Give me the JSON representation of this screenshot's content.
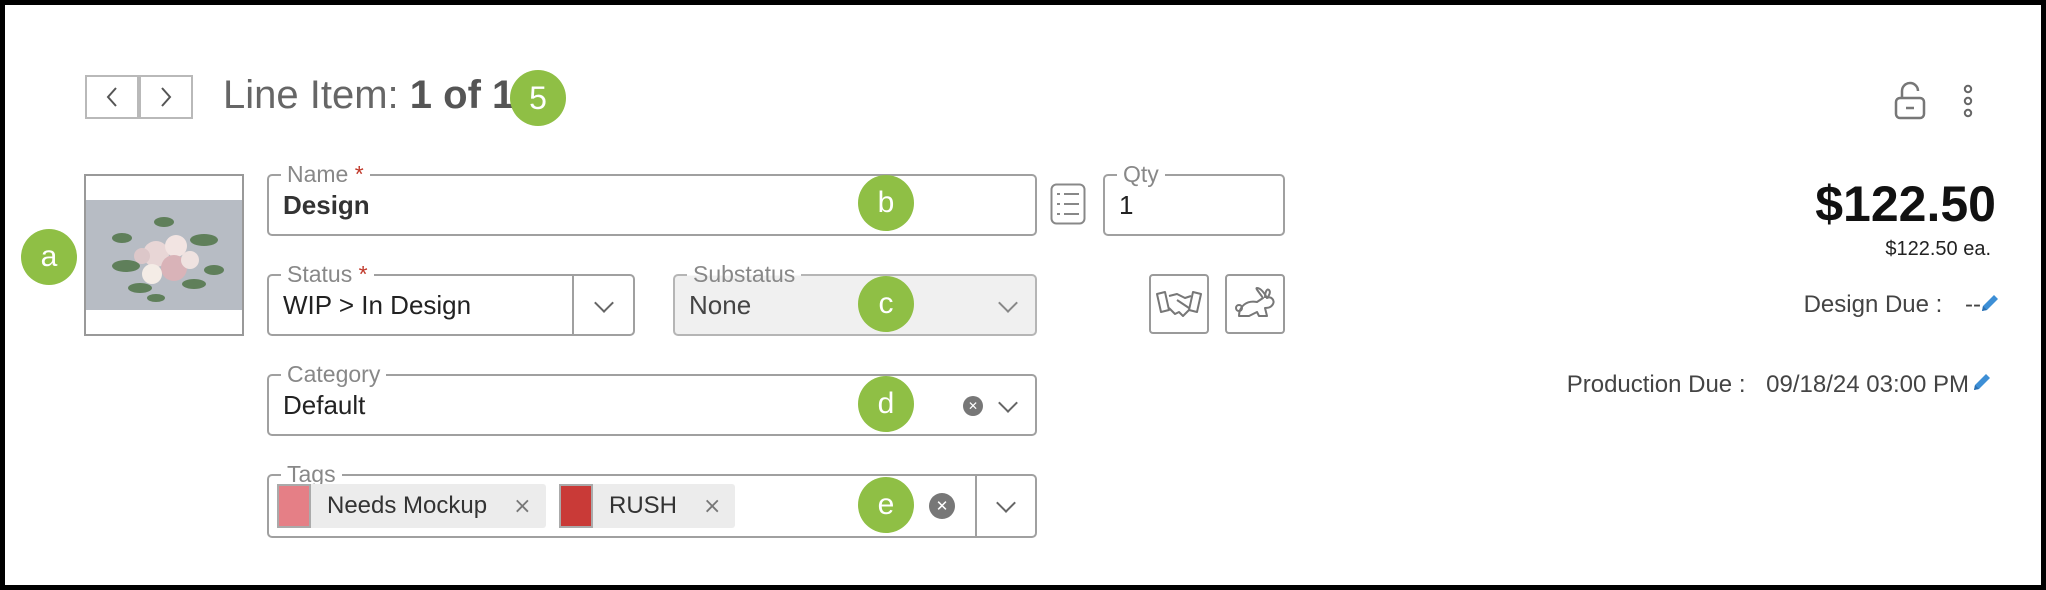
{
  "nav": {
    "title_prefix": "Line Item:",
    "title_position": "1 of 1",
    "badge": "5"
  },
  "callouts": {
    "a": "a",
    "b": "b",
    "c": "c",
    "d": "d",
    "e": "e"
  },
  "fields": {
    "name": {
      "label": "Name",
      "required_mark": "*",
      "value": "Design"
    },
    "qty": {
      "label": "Qty",
      "value": "1"
    },
    "status": {
      "label": "Status",
      "required_mark": "*",
      "value": "WIP > In Design"
    },
    "substatus": {
      "label": "Substatus",
      "value": "None"
    },
    "category": {
      "label": "Category",
      "value": "Default"
    },
    "tags": {
      "label": "Tags",
      "items": [
        {
          "label": "Needs Mockup",
          "color": "#e57f86"
        },
        {
          "label": "RUSH",
          "color": "#c93a37"
        }
      ]
    }
  },
  "pricing": {
    "total": "$122.50",
    "each": "$122.50 ea."
  },
  "dates": {
    "design_due_label": "Design Due :",
    "design_due_value": "--",
    "production_due_label": "Production Due :",
    "production_due_value": "09/18/24 03:00 PM"
  },
  "icons": [
    "chevron-left-icon",
    "chevron-right-icon",
    "unlock-icon",
    "kebab-menu-icon",
    "list-icon",
    "handshake-icon",
    "rabbit-icon",
    "pencil-icon",
    "clear-icon",
    "chevron-down-icon"
  ],
  "colors": {
    "badge": "#8fbf45",
    "pencil": "#3d8fd6",
    "required": "#c0392b"
  }
}
